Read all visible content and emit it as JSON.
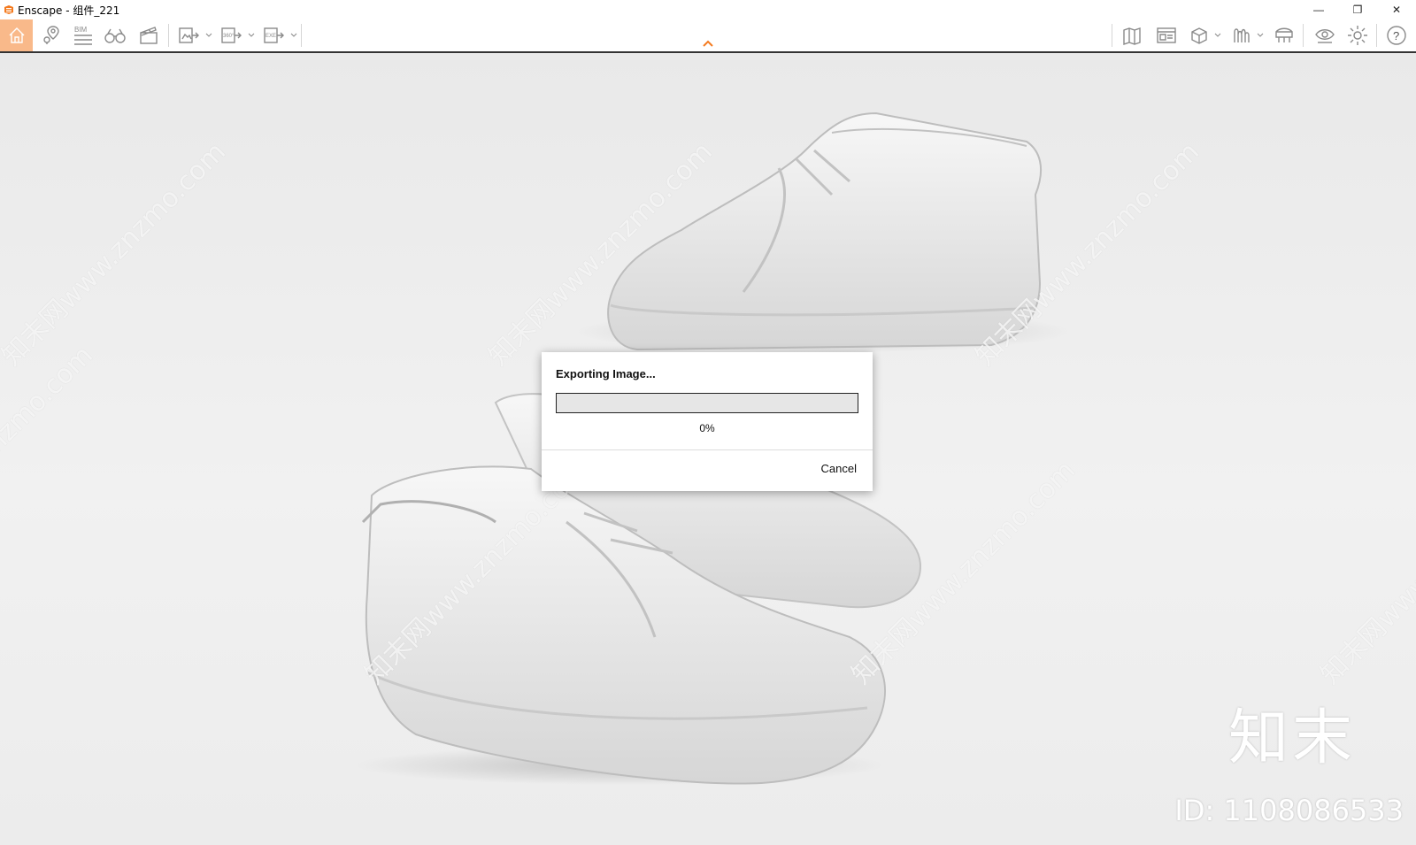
{
  "window": {
    "title": "Enscape - 组件_221",
    "minimize": "—",
    "restore": "❐",
    "close": "✕"
  },
  "toolbar": {
    "accent": "#f47b20",
    "icons": [
      "home-icon",
      "location-pin-icon",
      "bim-icon",
      "binoculars-icon",
      "clapperboard-icon",
      "export-image-icon",
      "export-panorama-icon",
      "export-exe-icon",
      "map-icon",
      "asset-library-icon",
      "cube-icon",
      "material-icon",
      "sky-icon",
      "visual-settings-icon",
      "settings-icon",
      "help-icon"
    ],
    "bim_label": "BIM",
    "panorama_label": "360°",
    "exe_label": "EXE",
    "help_label": "?"
  },
  "dialog": {
    "title": "Exporting Image...",
    "progress": 0,
    "progress_text": "0%",
    "cancel_label": "Cancel"
  },
  "watermarks": {
    "diagonal_text": "知末网www.znzmo.com",
    "corner_logo": "知末",
    "corner_id": "ID: 1108086533"
  }
}
